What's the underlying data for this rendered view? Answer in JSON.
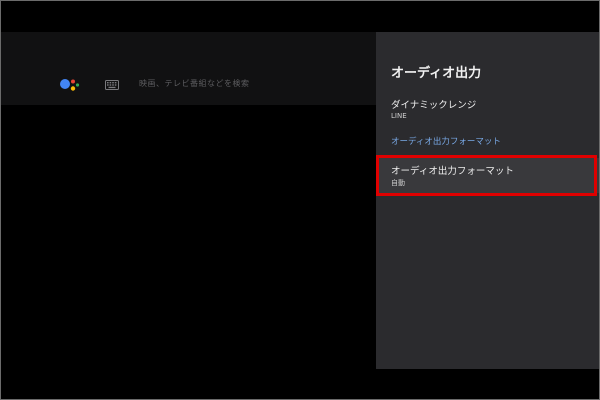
{
  "search": {
    "hint_text": "映画、テレビ番組などを検索"
  },
  "panel": {
    "title": "オーディオ出力",
    "items": [
      {
        "label": "ダイナミックレンジ",
        "value": "LINE"
      }
    ],
    "section_header": "オーディオ出力フォーマット",
    "selected_item": {
      "label": "オーディオ出力フォーマット",
      "value": "自動"
    }
  },
  "icons": {
    "assistant": "google-assistant-icon",
    "keyboard": "keyboard-icon"
  },
  "colors": {
    "panel_bg": "#2b2b2e",
    "section_header": "#79a9e6",
    "highlight": "#e00000",
    "assistant_blue": "#4285f4",
    "assistant_red": "#ea4335",
    "assistant_yellow": "#fbbc05",
    "assistant_green": "#34a853"
  }
}
